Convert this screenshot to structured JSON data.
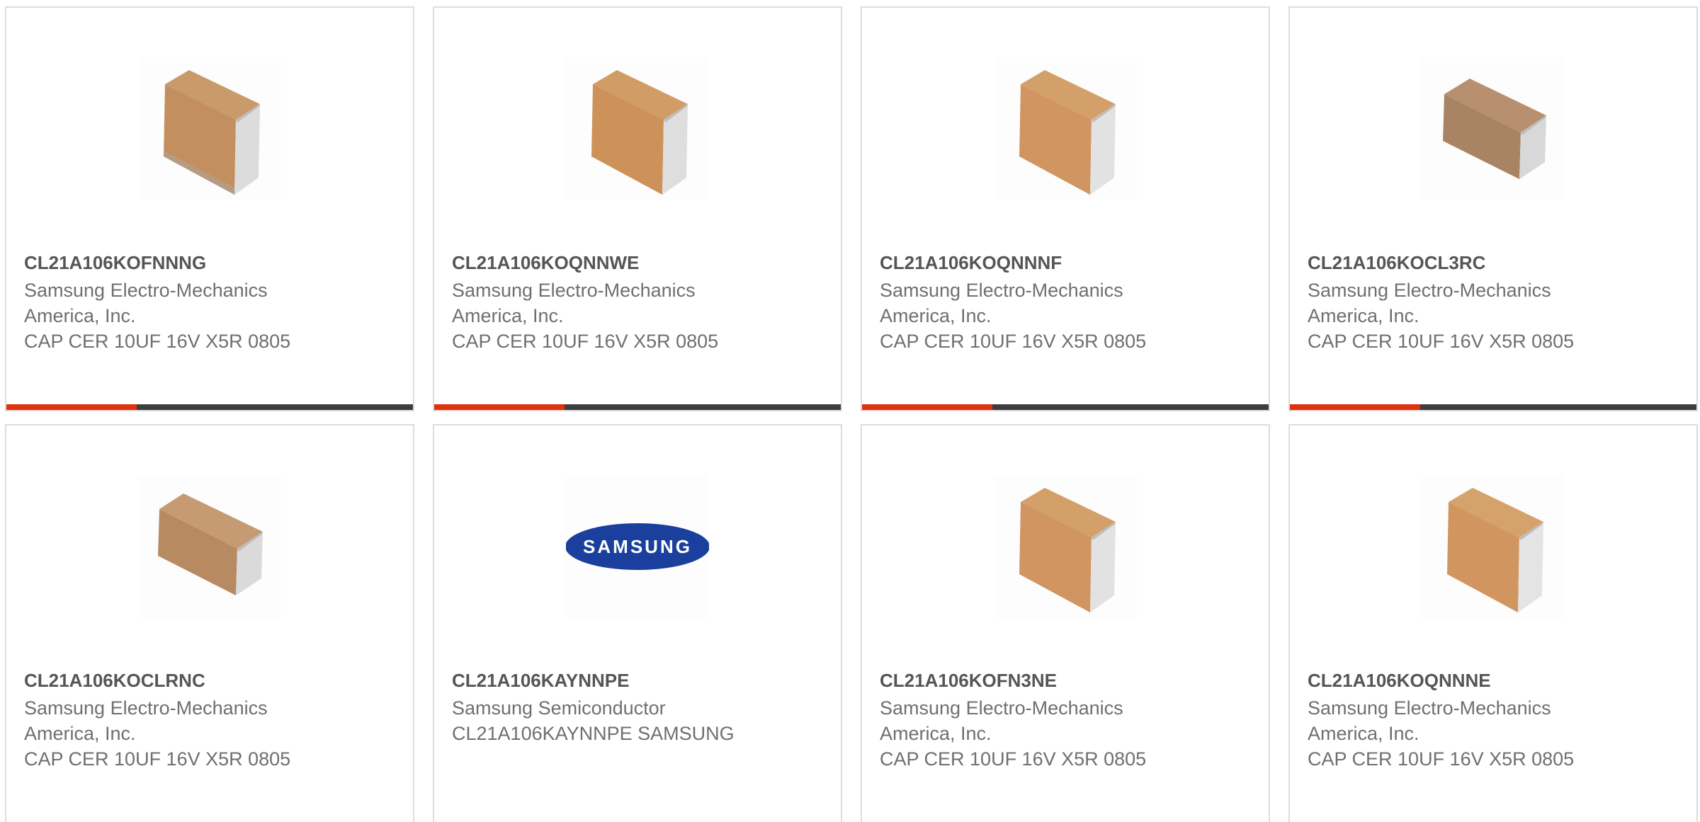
{
  "products": [
    {
      "part": "CL21A106KOFNNNG",
      "manufacturer": "Samsung Electro-Mechanics America, Inc.",
      "description": "CAP CER 10UF 16V X5R 0805",
      "image_icon": "ceramic-capacitor-chip-icon",
      "progress": 0.32
    },
    {
      "part": "CL21A106KOQNNWE",
      "manufacturer": "Samsung Electro-Mechanics America, Inc.",
      "description": "CAP CER 10UF 16V X5R 0805",
      "image_icon": "ceramic-capacitor-chip-icon",
      "progress": 0.32
    },
    {
      "part": "CL21A106KOQNNNF",
      "manufacturer": "Samsung Electro-Mechanics America, Inc.",
      "description": "CAP CER 10UF 16V X5R 0805",
      "image_icon": "ceramic-capacitor-chip-icon",
      "progress": 0.32
    },
    {
      "part": "CL21A106KOCL3RC",
      "manufacturer": "Samsung Electro-Mechanics America, Inc.",
      "description": "CAP CER 10UF 16V X5R 0805",
      "image_icon": "ceramic-capacitor-chip-icon",
      "progress": 0.32
    },
    {
      "part": "CL21A106KOCLRNC",
      "manufacturer": "Samsung Electro-Mechanics America, Inc.",
      "description": "CAP CER 10UF 16V X5R 0805",
      "image_icon": "ceramic-capacitor-chip-icon"
    },
    {
      "part": "CL21A106KAYNNPE",
      "manufacturer": "Samsung Semiconductor",
      "description": "CL21A106KAYNNPE SAMSUNG",
      "image_icon": "samsung-logo",
      "logo_text": "SAMSUNG"
    },
    {
      "part": "CL21A106KOFN3NE",
      "manufacturer": "Samsung Electro-Mechanics America, Inc.",
      "description": "CAP CER 10UF 16V X5R 0805",
      "image_icon": "ceramic-capacitor-chip-icon"
    },
    {
      "part": "CL21A106KOQNNNE",
      "manufacturer": "Samsung Electro-Mechanics America, Inc.",
      "description": "CAP CER 10UF 16V X5R 0805",
      "image_icon": "ceramic-capacitor-chip-icon"
    }
  ],
  "colors": {
    "progress_accent": "#e0300c",
    "progress_track": "#3d3d3d",
    "samsung_blue": "#1a3f9c",
    "card_border": "#dddddd"
  }
}
